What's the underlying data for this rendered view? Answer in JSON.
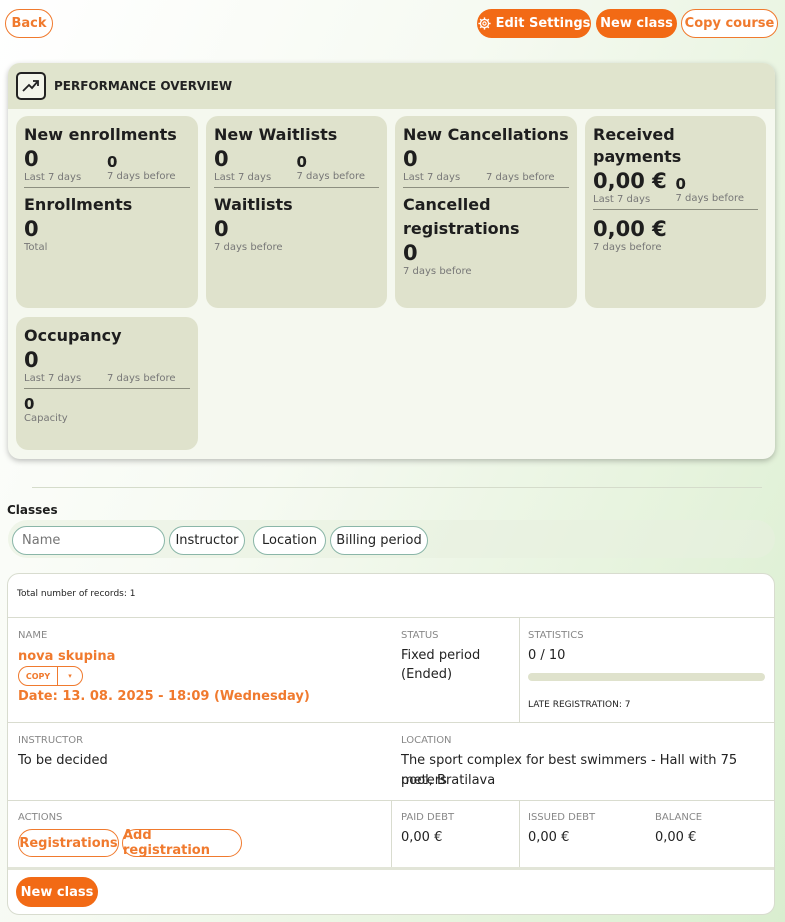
{
  "toolbar": {
    "back": "Back",
    "edit_settings": "Edit Settings",
    "new_class": "New class",
    "copy_course": "Copy course"
  },
  "performance": {
    "title": "PERFORMANCE OVERVIEW",
    "new_enrollments": {
      "title": "New enrollments",
      "last7": "0",
      "last7_label": "Last 7 days",
      "before": "0",
      "before_label": "7 days before"
    },
    "enrollments": {
      "title": "Enrollments",
      "value": "0",
      "label": "Total"
    },
    "new_waitlists": {
      "title": "New Waitlists",
      "last7": "0",
      "last7_label": "Last 7 days",
      "before": "0",
      "before_label": "7 days before"
    },
    "waitlists": {
      "title": "Waitlists",
      "value": "0",
      "label": "7 days before"
    },
    "new_cancellations": {
      "title": "New Cancellations",
      "last7": "0",
      "last7_label": "Last 7 days",
      "before_label": "7 days before"
    },
    "cancelled": {
      "title_line1": "Cancelled",
      "title_line2": "registrations",
      "value": "0",
      "label": "7 days before"
    },
    "received_payments": {
      "title": "Received payments",
      "last7": "0,00 €",
      "last7_label": "Last 7 days",
      "before": "0",
      "before_label": "7 days before",
      "value": "0,00 €",
      "label": "7 days before"
    },
    "occupancy": {
      "title": "Occupancy",
      "last7": "0",
      "last7_label": "Last 7 days",
      "before_label": "7 days before",
      "capacity": "0",
      "capacity_label": "Capacity"
    }
  },
  "classes": {
    "label": "Classes",
    "filters": {
      "name_placeholder": "Name",
      "instructor": "Instructor",
      "location": "Location",
      "billing_period": "Billing period"
    },
    "total_records": "Total number of records: 1",
    "columns": {
      "name": "NAME",
      "status": "STATUS",
      "statistics": "STATISTICS",
      "instructor": "INSTRUCTOR",
      "location": "LOCATION",
      "actions": "ACTIONS",
      "paid_debt": "PAID DEBT",
      "issued_debt": "ISSUED DEBT",
      "balance": "BALANCE"
    },
    "row": {
      "name": "nova skupina",
      "copy": "COPY",
      "copy_dropdown": "▾",
      "date": "Date: 13. 08. 2025 - 18:09 (Wednesday)",
      "status_line1": "Fixed period",
      "status_line2": "(Ended)",
      "stats": "0 / 10",
      "stats_fraction": 0,
      "late_registration": "LATE REGISTRATION: 7",
      "instructor": "To be decided",
      "location_line1": "The sport complex for best swimmers - Hall with 75 meters",
      "location_line2": "pool, Bratilava",
      "registrations_btn": "Registrations",
      "add_registration_btn": "Add registration",
      "paid_debt": "0,00 €",
      "issued_debt": "0,00 €",
      "balance": "0,00 €"
    },
    "new_class_btn": "New class"
  },
  "colors": {
    "accent": "#f26a15",
    "card": "#dfe2cc"
  }
}
